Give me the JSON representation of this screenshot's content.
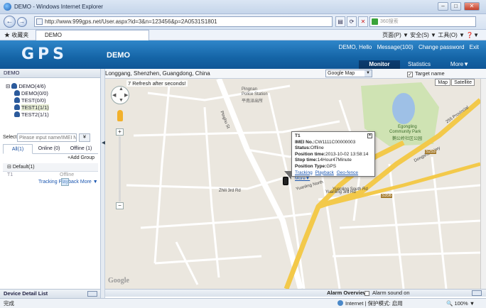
{
  "browser": {
    "window_title": "DEMO - Windows Internet Explorer",
    "url": "http://www.999gps.net/User.aspx?id=3&n=123456&p=2A0531S1801",
    "search_placeholder": "360搜索",
    "favorites_label": "收藏夹",
    "tab_label": "DEMO",
    "tools_menu": "页面(P) ▼  安全(S) ▼  工具(O) ▼  ❓▼"
  },
  "app": {
    "logo": "GPS",
    "title": "DEMO",
    "top_links": [
      "DEMO, Hello",
      "Message(100)",
      "Change password",
      "Exit"
    ],
    "tabs": [
      "Monitor",
      "Statistics",
      "More▼"
    ]
  },
  "left": {
    "header": "DEMO",
    "tree": [
      {
        "label": "DEMO(4/6)"
      },
      {
        "label": "DEMO(0/0)"
      },
      {
        "label": "TEST(0/0)"
      },
      {
        "label": "TEST1(1/1)"
      },
      {
        "label": "TEST2(1/1)"
      }
    ],
    "select_label": "Select",
    "search_placeholder": "Please input name/IMEI No.",
    "filter_tabs": [
      "All(1)",
      "Online (0)",
      "Offline (1)"
    ],
    "add_group": "+Add Group",
    "group_name": "Default(1)",
    "device": {
      "name": "T1",
      "status": "Offline",
      "links": "Tracking Playback More ▼"
    },
    "detail_list": "Device Detail List"
  },
  "map": {
    "location": "Longgang, Shenzhen, Guangdong, China",
    "map_type": "Google Map",
    "target_name_label": "Target name",
    "target_name_checked": true,
    "refresh_note": "7 Refresh after seconds!",
    "btn_map": "Map",
    "btn_satellite": "Satellite",
    "google": "Google",
    "labels": {
      "pingnan": "Pingnan",
      "police": "Police Station",
      "police_cn": "平南派出所",
      "egongling": "Egongling",
      "community_park": "Community Park",
      "park_cn": "鹅公岭社区公园",
      "dongshan": "Dongshan Hwy",
      "yuanling3": "Yuanling 3rd Rd",
      "yuanling_north": "Yuanling North",
      "yuanling_south": "Yuanling South Rd",
      "zhili3": "Zhili 3rd Rd",
      "pinghu": "Pinghu St",
      "provincial": "255 Provincial",
      "s253": "S253",
      "s356": "S356"
    },
    "info": {
      "title": "T1",
      "imei_label": "IMEI No.:",
      "imei": "CW1111C00000003",
      "status_label": "Status:",
      "status": "Offline",
      "position_time_label": "Position time:",
      "position_time": "2013-10-02 13:58:14",
      "stop_time_label": "Stop time:",
      "stop_time": "14Hour47Minute",
      "position_type_label": "Position Type:",
      "position_type": "GPS",
      "links": [
        "Tracking",
        "Playback",
        "Geo-fence",
        "More▼"
      ]
    }
  },
  "alarm": {
    "overview": "Alarm Overview",
    "sound_on": "Alarm sound on"
  },
  "status": {
    "done": "完成",
    "zone": "Internet | 保护模式: 启用",
    "zoom": "100%"
  },
  "colors": {
    "header": "#1565a7",
    "park": "#cfe3b3",
    "lake": "#9ec0e6",
    "highway": "#f3c94a"
  }
}
